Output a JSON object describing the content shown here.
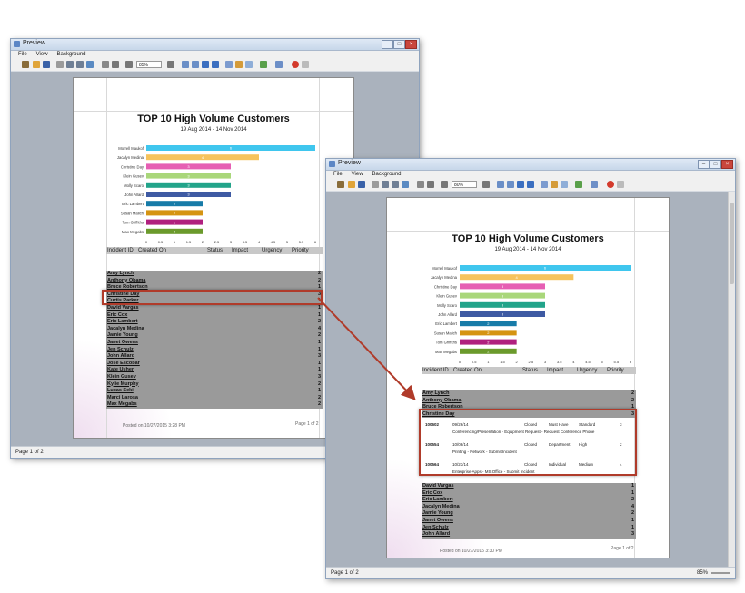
{
  "window1": {
    "title": "Preview",
    "menu": [
      "File",
      "View",
      "Background"
    ],
    "zoom": "85%",
    "status_left": "Page 1 of 2",
    "status_zoom": ""
  },
  "window2": {
    "title": "Preview",
    "menu": [
      "File",
      "View",
      "Background"
    ],
    "zoom": "80%",
    "status_left": "Page 1 of 2",
    "status_zoom": "85%"
  },
  "report": {
    "title": "TOP 10 High Volume Customers",
    "dates": "19 Aug 2014   -   14 Nov 2014",
    "columns": [
      "Incident ID",
      "Created On",
      "Status",
      "Impact",
      "Urgency",
      "Priority"
    ],
    "footer_left_1": "Posted on 10/27/2015 3:28 PM",
    "footer_right_1": "Page 1 of 2",
    "footer_left_2": "Posted on 10/27/2015 3:30 PM",
    "footer_right_2": "Page 1 of 2"
  },
  "chart_data": {
    "type": "bar",
    "categories": [
      "Morrell Maukof",
      "Jacalyn Medina",
      "Christine Day",
      "Klein Gusev",
      "Molly Scaro",
      "John Allard",
      "Eric Lambert",
      "Susan Malich",
      "Tom Griffiths",
      "Max Megabs"
    ],
    "values": [
      6,
      4,
      3,
      3,
      3,
      3,
      2,
      2,
      2,
      2
    ],
    "colors": [
      "#3fc6ee",
      "#f6c35c",
      "#e65fb3",
      "#a9d77a",
      "#22a48a",
      "#3e5aa3",
      "#177ba8",
      "#d59412",
      "#b0207e",
      "#6b9a2c"
    ],
    "x_ticks": [
      "0",
      "0.5",
      "1",
      "1.5",
      "2",
      "2.5",
      "3",
      "3.5",
      "4",
      "4.5",
      "5",
      "5.5",
      "6"
    ],
    "xlim": [
      0,
      6
    ],
    "title": "",
    "xlabel": "",
    "ylabel": ""
  },
  "rows_page1": [
    {
      "name": "Amy Lynch",
      "count": "2"
    },
    {
      "name": "Anthony Obama",
      "count": "2"
    },
    {
      "name": "Bruce Robertson",
      "count": "1"
    },
    {
      "name": "Christine Day",
      "count": "3"
    },
    {
      "name": "Curtis Parker",
      "count": "1"
    },
    {
      "name": "David Vargas",
      "count": "1"
    },
    {
      "name": "Eric Cox",
      "count": "1"
    },
    {
      "name": "Eric Lambert",
      "count": "2"
    },
    {
      "name": "Jacalyn Medina",
      "count": "4"
    },
    {
      "name": "Jamie Young",
      "count": "2"
    },
    {
      "name": "Janet Owens",
      "count": "1"
    },
    {
      "name": "Jen Schulz",
      "count": "1"
    },
    {
      "name": "John Allard",
      "count": "3"
    },
    {
      "name": "Jose Escobar",
      "count": "1"
    },
    {
      "name": "Kate Usher",
      "count": "1"
    },
    {
      "name": "Klein Gusev",
      "count": "3"
    },
    {
      "name": "Kylie Murphy",
      "count": "2"
    },
    {
      "name": "Lucas Seki",
      "count": "1"
    },
    {
      "name": "Marci Larosa",
      "count": "2"
    },
    {
      "name": "Max Megabs",
      "count": "2"
    }
  ],
  "rows_page2_top": [
    {
      "name": "Amy Lynch",
      "count": "2"
    },
    {
      "name": "Anthony Obama",
      "count": "2"
    },
    {
      "name": "Bruce Robertson",
      "count": "1"
    },
    {
      "name": "Christine Day",
      "count": "3"
    }
  ],
  "rows_page2_bottom": [
    {
      "name": "David Vargas",
      "count": "1"
    },
    {
      "name": "Eric Cox",
      "count": "1"
    },
    {
      "name": "Eric Lambert",
      "count": "2"
    },
    {
      "name": "Jacalyn Medina",
      "count": "4"
    },
    {
      "name": "Jamie Young",
      "count": "2"
    },
    {
      "name": "Janet Owens",
      "count": "1"
    },
    {
      "name": "Jen Schulz",
      "count": "1"
    },
    {
      "name": "John Allard",
      "count": "3"
    }
  ],
  "details": [
    {
      "id": "100602",
      "date": "09/26/14",
      "status": "Closed",
      "impact": "Must Have",
      "urgency": "Standard",
      "priority": "3",
      "desc": "Conferencing/Presentation - Equipment Request - Request Conference Phone"
    },
    {
      "id": "100554",
      "date": "10/08/14",
      "status": "Closed",
      "impact": "Department",
      "urgency": "High",
      "priority": "2",
      "desc": "Printing - Network - Submit Incident"
    },
    {
      "id": "100564",
      "date": "10/23/14",
      "status": "Closed",
      "impact": "Individual",
      "urgency": "Medium",
      "priority": "4",
      "desc": "Enterprise Apps - MS Office - Submit Incident"
    }
  ]
}
